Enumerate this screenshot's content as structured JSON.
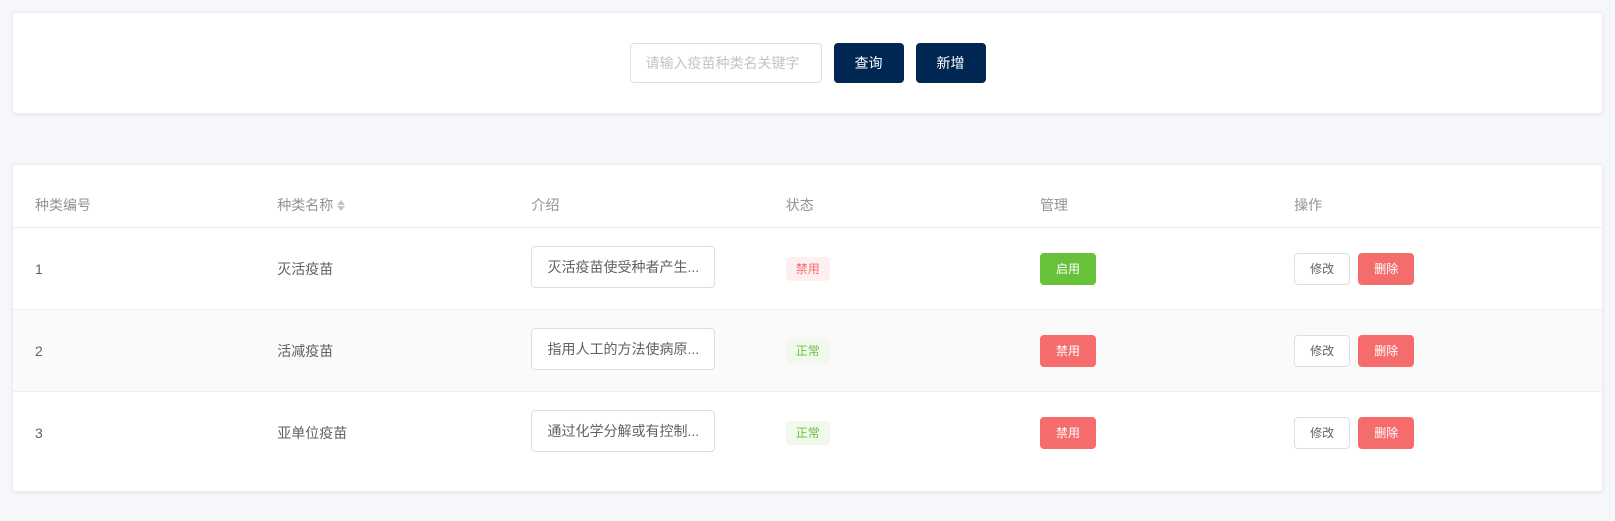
{
  "search": {
    "placeholder": "请输入疫苗种类名关键字",
    "value": "",
    "queryLabel": "查询",
    "addLabel": "新增"
  },
  "table": {
    "columns": {
      "id": "种类编号",
      "name": "种类名称",
      "desc": "介绍",
      "status": "状态",
      "manage": "管理",
      "op": "操作"
    },
    "statusLabels": {
      "disabled": "禁用",
      "normal": "正常"
    },
    "manageLabels": {
      "enable": "启用",
      "disable": "禁用"
    },
    "opLabels": {
      "edit": "修改",
      "delete": "删除"
    },
    "rows": [
      {
        "id": "1",
        "name": "灭活疫苗",
        "desc": "灭活疫苗使受种者产生...",
        "status": "disabled",
        "manageAction": "enable"
      },
      {
        "id": "2",
        "name": "活减疫苗",
        "desc": "指用人工的方法使病原...",
        "status": "normal",
        "manageAction": "disable"
      },
      {
        "id": "3",
        "name": "亚单位疫苗",
        "desc": "通过化学分解或有控制...",
        "status": "normal",
        "manageAction": "disable"
      }
    ]
  }
}
